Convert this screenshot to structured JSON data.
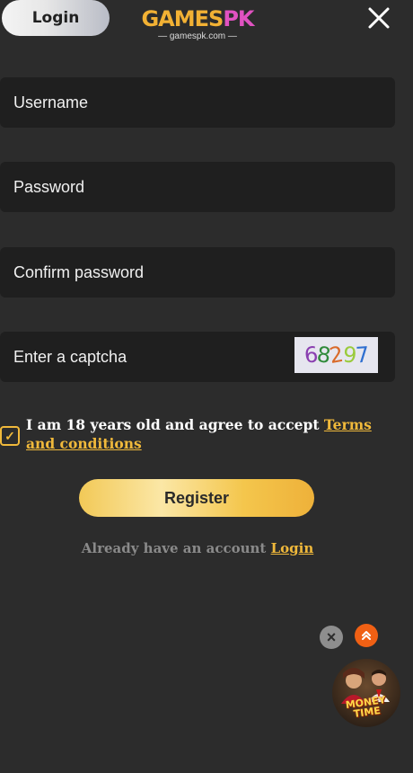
{
  "header": {
    "login_label": "Login",
    "logo_games": "GAMES",
    "logo_pk": "PK",
    "logo_domain": "— gamespk.com —",
    "close_icon": "close-icon"
  },
  "form": {
    "username_placeholder": "Username",
    "password_placeholder": "Password",
    "confirm_placeholder": "Confirm password",
    "captcha_placeholder": "Enter a captcha",
    "captcha_digits": [
      "6",
      "8",
      "2",
      "9",
      "7"
    ],
    "captcha_colors": [
      "#8a3fb0",
      "#2f8a3a",
      "#d96a2a",
      "#9acb3c",
      "#2f6fd0"
    ]
  },
  "agreement": {
    "checked": true,
    "text": "I am 18 years old and agree to accept ",
    "terms_link": "Terms and conditions"
  },
  "register_label": "Register",
  "footer": {
    "already_text": "Already have an account ",
    "login_link": "Login"
  },
  "promo": {
    "text_line1": "MONEY",
    "text_line2": "TIME"
  },
  "colors": {
    "accent": "#f0b93b",
    "background": "#2c2c2c",
    "field": "#1f1f1f",
    "scroll_top": "#f06014"
  }
}
